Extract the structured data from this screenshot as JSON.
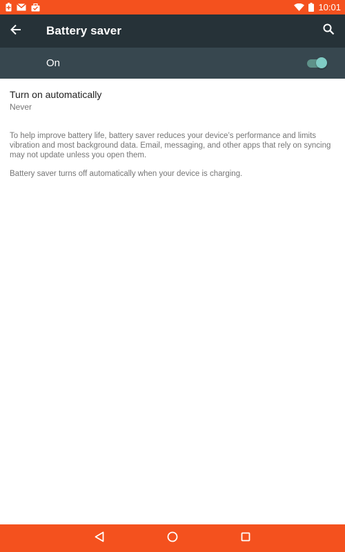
{
  "status_bar": {
    "time": "10:01",
    "notification_icons": [
      "battery-saver-notification-icon",
      "gmail-icon",
      "briefcase-notification-icon"
    ],
    "system_icons": [
      "wifi-icon",
      "battery-icon"
    ],
    "background_color": "#F4511E"
  },
  "toolbar": {
    "title": "Battery saver",
    "back_icon": "arrow-back-icon",
    "search_icon": "search-icon",
    "background_color": "#263238"
  },
  "master_switch": {
    "label": "On",
    "checked": true,
    "background_color": "#37474F",
    "accent_color": "#80CBC4"
  },
  "preference": {
    "title": "Turn on automatically",
    "summary": "Never"
  },
  "footer": {
    "description": "To help improve battery life, battery saver reduces your device’s performance and limits vibration and most background data. Email, messaging, and other apps that rely on syncing may not update unless you open them.",
    "note": "Battery saver turns off automatically when your device is charging."
  },
  "nav_bar": {
    "icons": [
      "back-triangle-icon",
      "home-circle-icon",
      "recents-square-icon"
    ],
    "background_color": "#F4511E"
  }
}
